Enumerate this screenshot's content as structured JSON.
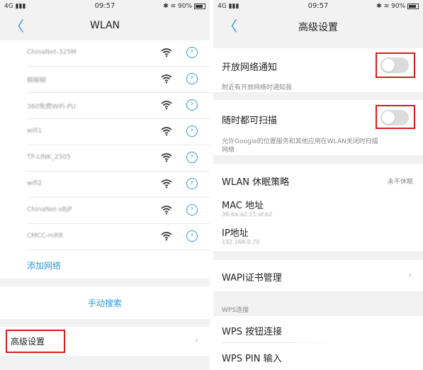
{
  "left": {
    "status": {
      "carrier": "4G",
      "time": "09:57",
      "battery": "90%"
    },
    "nav": {
      "back": "〈",
      "title": "WLAN"
    },
    "networks": [
      {
        "name": "ChinaNet-325M"
      },
      {
        "name": "柳柳柳"
      },
      {
        "name": "360免费WiFi-PU"
      },
      {
        "name": "wifi1"
      },
      {
        "name": "TP-LINK_2505"
      },
      {
        "name": "wifi2"
      },
      {
        "name": "ChinaNet-sBjP"
      },
      {
        "name": "CMCC-mR8"
      }
    ],
    "add_network": "添加网络",
    "manual_search": "手动搜索",
    "advanced_settings": "高级设置",
    "chevron": "›"
  },
  "right": {
    "status": {
      "carrier": "4G",
      "time": "09:57",
      "battery": "90%"
    },
    "nav": {
      "back": "〈",
      "title": "高级设置"
    },
    "open_network_notify": {
      "label": "开放网络通知",
      "desc": "附近有开放网络时通知我",
      "enabled": false
    },
    "always_scan": {
      "label": "随时都可扫描",
      "desc_line1": "允许Google的位置服务和其他应用在WLAN关闭时扫描",
      "desc_line2": "网络",
      "enabled": false
    },
    "sleep_policy": {
      "label": "WLAN 休眠策略",
      "value": "永不休眠"
    },
    "mac": {
      "label": "MAC 地址",
      "value": "38:6a:a2:11:af:b2"
    },
    "ip": {
      "label": "IP地址",
      "value": "192.168.0.70"
    },
    "wapi": {
      "label": "WAPI证书管理"
    },
    "wps_header": "WPS连接",
    "wps_button": "WPS 按钮连接",
    "wps_pin": "WPS PIN 输入",
    "chevron": "›"
  },
  "colors": {
    "accent": "#2d9bd6",
    "highlight": "#d61c1c",
    "background": "#f2f2f2"
  }
}
